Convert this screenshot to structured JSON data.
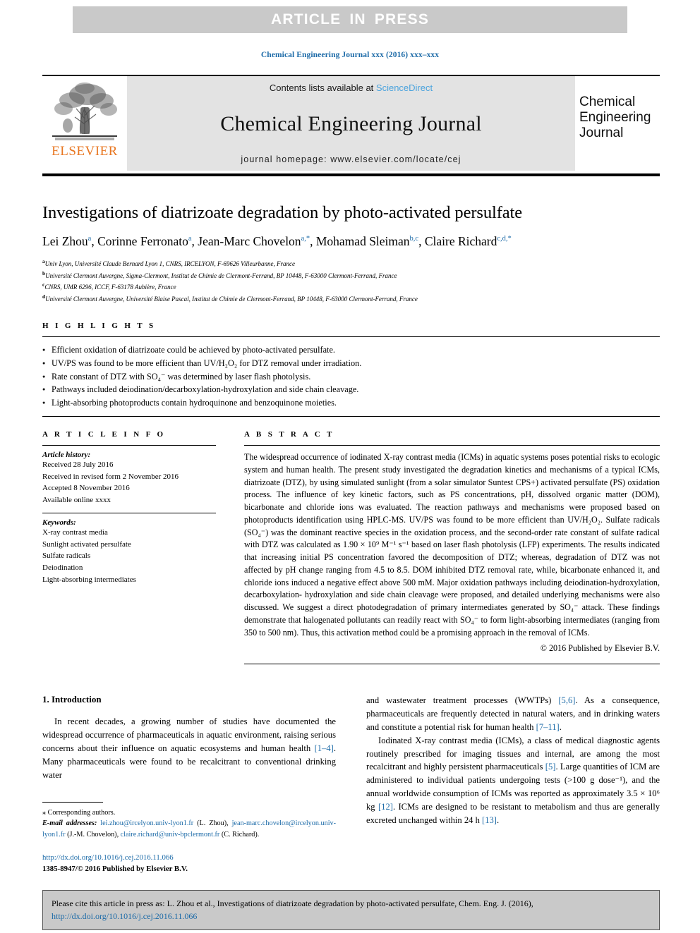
{
  "banner": {
    "text": "ARTICLE IN PRESS",
    "bg_color": "#c9c9c9",
    "text_color": "#ffffff"
  },
  "running_head": "Chemical Engineering Journal xxx (2016) xxx–xxx",
  "masthead": {
    "contents_prefix": "Contents lists available at ",
    "sciencedirect": "ScienceDirect",
    "journal_title": "Chemical Engineering Journal",
    "homepage": "journal homepage: www.elsevier.com/locate/cej",
    "publisher_logo_text": "ELSEVIER",
    "publisher_logo_color": "#e87722",
    "cover_line_1": "Chemical",
    "cover_line_2": "Engineering",
    "cover_line_3": "Journal",
    "link_color": "#4ba3dd"
  },
  "article": {
    "title": "Investigations of diatrizoate degradation by photo-activated persulfate",
    "authors": [
      {
        "name": "Lei Zhou",
        "sup": "a"
      },
      {
        "name": "Corinne Ferronato",
        "sup": "a"
      },
      {
        "name": "Jean-Marc Chovelon",
        "sup": "a,*"
      },
      {
        "name": "Mohamad Sleiman",
        "sup": "b,c"
      },
      {
        "name": "Claire Richard",
        "sup": "c,d,*"
      }
    ],
    "affiliations": [
      {
        "mark": "a",
        "text": "Univ Lyon, Université Claude Bernard Lyon 1, CNRS, IRCELYON, F-69626 Villeurbanne, France"
      },
      {
        "mark": "b",
        "text": "Université Clermont Auvergne, Sigma-Clermont, Institut de Chimie de Clermont-Ferrand, BP 10448, F-63000 Clermont-Ferrand, France"
      },
      {
        "mark": "c",
        "text": "CNRS, UMR 6296, ICCF, F-63178 Aubière, France"
      },
      {
        "mark": "d",
        "text": "Université Clermont Auvergne, Université Blaise Pascal, Institut de Chimie de Clermont-Ferrand, BP 10448, F-63000 Clermont-Ferrand, France"
      }
    ]
  },
  "highlights": {
    "label": "H I G H L I G H T S",
    "items": [
      "Efficient oxidation of diatrizoate could be achieved by photo-activated persulfate.",
      "UV/PS was found to be more efficient than UV/H₂O₂ for DTZ removal under irradiation.",
      "Rate constant of DTZ with SO₄⁻ was determined by laser flash photolysis.",
      "Pathways included deiodination/decarboxylation-hydroxylation and side chain cleavage.",
      "Light-absorbing photoproducts contain hydroquinone and benzoquinone moieties."
    ]
  },
  "article_info": {
    "label": "A R T I C L E    I N F O",
    "history_title": "Article history:",
    "history": [
      "Received 28 July 2016",
      "Received in revised form 2 November 2016",
      "Accepted 8 November 2016",
      "Available online xxxx"
    ],
    "keywords_title": "Keywords:",
    "keywords": [
      "X-ray contrast media",
      "Sunlight activated persulfate",
      "Sulfate radicals",
      "Deiodination",
      "Light-absorbing intermediates"
    ]
  },
  "abstract": {
    "label": "A B S T R A C T",
    "text": "The widespread occurrence of iodinated X-ray contrast media (ICMs) in aquatic systems poses potential risks to ecologic system and human health. The present study investigated the degradation kinetics and mechanisms of a typical ICMs, diatrizoate (DTZ), by using simulated sunlight (from a solar simulator Suntest CPS+) activated persulfate (PS) oxidation process. The influence of key kinetic factors, such as PS concentrations, pH, dissolved organic matter (DOM), bicarbonate and chloride ions was evaluated. The reaction pathways and mechanisms were proposed based on photoproducts identification using HPLC-MS. UV/PS was found to be more efficient than UV/H₂O₂. Sulfate radicals (SO₄⁻) was the dominant reactive species in the oxidation process, and the second-order rate constant of sulfate radical with DTZ was calculated as 1.90 × 10⁹ M⁻¹ s⁻¹ based on laser flash photolysis (LFP) experiments. The results indicated that increasing initial PS concentration favored the decomposition of DTZ; whereas, degradation of DTZ was not affected by pH change ranging from 4.5 to 8.5. DOM inhibited DTZ removal rate, while, bicarbonate enhanced it, and chloride ions induced a negative effect above 500 mM. Major oxidation pathways including deiodination-hydroxylation, decarboxylation- hydroxylation and side chain cleavage were proposed, and detailed underlying mechanisms were also discussed. We suggest a direct photodegradation of primary intermediates generated by SO₄⁻ attack. These findings demonstrate that halogenated pollutants can readily react with SO₄⁻ to form light-absorbing intermediates (ranging from 350 to 500 nm). Thus, this activation method could be a promising approach in the removal of ICMs.",
    "copyright": "© 2016 Published by Elsevier B.V."
  },
  "introduction": {
    "heading": "1. Introduction",
    "left_paragraphs": [
      {
        "segments": [
          {
            "t": "In recent decades, a growing number of studies have documented the widespread occurrence of pharmaceuticals in aquatic environment, raising serious concerns about their influence on aquatic ecosystems and human health "
          },
          {
            "t": "[1–4]",
            "ref": true
          },
          {
            "t": ". Many pharmaceuticals were found to be recalcitrant to conventional drinking water"
          }
        ]
      }
    ],
    "right_paragraphs": [
      {
        "indent": false,
        "segments": [
          {
            "t": "and wastewater treatment processes (WWTPs) "
          },
          {
            "t": "[5,6]",
            "ref": true
          },
          {
            "t": ". As a consequence, pharmaceuticals are frequently detected in natural waters, and in drinking waters and constitute a potential risk for human health "
          },
          {
            "t": "[7–11]",
            "ref": true
          },
          {
            "t": "."
          }
        ]
      },
      {
        "indent": true,
        "segments": [
          {
            "t": "Iodinated X-ray contrast media (ICMs), a class of medical diagnostic agents routinely prescribed for imaging tissues and internal, are among the most recalcitrant and highly persistent pharmaceuticals "
          },
          {
            "t": "[5]",
            "ref": true
          },
          {
            "t": ". Large quantities of ICM are administered to individual patients undergoing tests (>100 g dose⁻¹), and the annual worldwide consumption of ICMs was reported as approximately 3.5 × 10⁶ kg "
          },
          {
            "t": "[12]",
            "ref": true
          },
          {
            "t": ". ICMs are designed to be resistant to metabolism and thus are generally excreted unchanged within 24 h "
          },
          {
            "t": "[13]",
            "ref": true
          },
          {
            "t": "."
          }
        ]
      }
    ]
  },
  "footnote": {
    "corresponding": "⁎ Corresponding authors.",
    "email_label": "E-mail addresses:",
    "emails": [
      {
        "address": "lei.zhou@ircelyon.univ-lyon1.fr",
        "person": "(L. Zhou)"
      },
      {
        "address": "jean-marc.chovelon@ircelyon.univ-lyon1.fr",
        "person": "(J.-M. Chovelon)"
      },
      {
        "address": "claire.richard@univ-bpclermont.fr",
        "person": "(C. Richard)"
      }
    ],
    "doi": "http://dx.doi.org/10.1016/j.cej.2016.11.066",
    "issn_line": "1385-8947/© 2016 Published by Elsevier B.V."
  },
  "cite_box": {
    "prefix": "Please cite this article in press as: L. Zhou et al., Investigations of diatrizoate degradation by photo-activated persulfate, Chem. Eng. J. (2016), ",
    "link": "http://dx.doi.org/10.1016/j.cej.2016.11.066"
  }
}
